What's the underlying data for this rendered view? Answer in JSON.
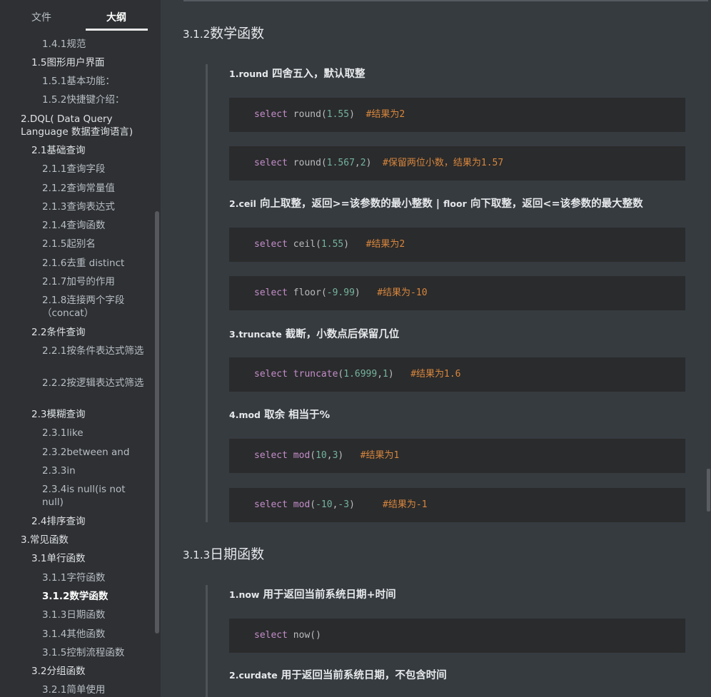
{
  "sidebar": {
    "tabs": {
      "files": "文件",
      "outline": "大纲"
    },
    "items": [
      {
        "level": 3,
        "text": "1.4.1规范"
      },
      {
        "level": 2,
        "text": "1.5图形用户界面"
      },
      {
        "level": 3,
        "text": "1.5.1基本功能："
      },
      {
        "level": 3,
        "text": "1.5.2快捷键介绍："
      },
      {
        "level": 1,
        "text": "2.DQL( Data Query Language 数据查询语言)"
      },
      {
        "level": 2,
        "text": "2.1基础查询"
      },
      {
        "level": 3,
        "text": "2.1.1查询字段"
      },
      {
        "level": 3,
        "text": "2.1.2查询常量值"
      },
      {
        "level": 3,
        "text": "2.1.3查询表达式"
      },
      {
        "level": 3,
        "text": "2.1.4查询函数"
      },
      {
        "level": 3,
        "text": "2.1.5起别名"
      },
      {
        "level": 3,
        "text": "2.1.6去重 distinct"
      },
      {
        "level": 3,
        "text": "2.1.7加号的作用"
      },
      {
        "level": 3,
        "text": "2.1.8连接两个字段（concat）"
      },
      {
        "level": 2,
        "text": "2.2条件查询"
      },
      {
        "level": 3,
        "text": "2.2.1按条件表达式筛选"
      },
      {
        "level": 3,
        "text": "2.2.2按逻辑表达式筛选"
      },
      {
        "level": 2,
        "text": "2.3模糊查询"
      },
      {
        "level": 3,
        "text": "2.3.1like"
      },
      {
        "level": 3,
        "text": "2.3.2between and"
      },
      {
        "level": 3,
        "text": "2.3.3in"
      },
      {
        "level": 3,
        "text": "2.3.4is null(is not null)"
      },
      {
        "level": 2,
        "text": "2.4排序查询"
      },
      {
        "level": 1,
        "text": "3.常见函数"
      },
      {
        "level": 2,
        "text": "3.1单行函数"
      },
      {
        "level": 3,
        "text": "3.1.1字符函数"
      },
      {
        "level": 3,
        "text": "3.1.2数学函数"
      },
      {
        "level": 3,
        "text": "3.1.3日期函数"
      },
      {
        "level": 3,
        "text": "3.1.4其他函数"
      },
      {
        "level": 3,
        "text": "3.1.5控制流程函数"
      },
      {
        "level": 2,
        "text": "3.2分组函数"
      },
      {
        "level": 3,
        "text": "3.2.1简单使用"
      }
    ]
  },
  "content": {
    "section_math": {
      "num": "3.1.2",
      "title": "数学函数"
    },
    "round_head": {
      "lat": "1.round",
      "rest": " 四舍五入，默认取整"
    },
    "code_round1": {
      "kw": "select",
      "fn": "round",
      "open": "(",
      "a": "1.55",
      "close": ")",
      "gap": "  ",
      "cmt": "#结果为2"
    },
    "code_round2": {
      "kw": "select",
      "fn": "round",
      "open": "(",
      "a": "1.567",
      "comma": ",",
      "b": "2",
      "close": ")",
      "gap": "  ",
      "cmt": "#保留两位小数，结果为1.57"
    },
    "ceil_head": {
      "lat1": "2.ceil",
      "mid1": " 向上取整，返回>=该参数的最小整数 | ",
      "lat2": "floor",
      "mid2": " 向下取整，返回<=该参数的最大整数"
    },
    "code_ceil": {
      "kw": "select",
      "fn": "ceil",
      "open": "(",
      "a": "1.55",
      "close": ")",
      "gap": "   ",
      "cmt": "#结果为2"
    },
    "code_floor": {
      "kw": "select",
      "fn": "floor",
      "open": "(",
      "a": "-9.99",
      "close": ")",
      "gap": "   ",
      "cmt": "#结果为-10"
    },
    "truncate_head": {
      "lat": "3.truncate",
      "rest": " 截断，小数点后保留几位"
    },
    "code_truncate": {
      "kw": "select",
      "fn": "truncate",
      "open": "(",
      "a": "1.6999",
      "comma": ",",
      "b": "1",
      "close": ")",
      "gap": "   ",
      "cmt": "#结果为1.6"
    },
    "mod_head": {
      "lat": "4.mod",
      "rest": " 取余 相当于%"
    },
    "code_mod1": {
      "kw": "select",
      "fn": "mod",
      "open": "(",
      "a": "10",
      "comma": ",",
      "b": "3",
      "close": ")",
      "gap": "   ",
      "cmt": "#结果为1"
    },
    "code_mod2": {
      "kw": "select",
      "fn": "mod",
      "open": "(",
      "a": "-10",
      "comma": ",",
      "b": "-3",
      "close": ")",
      "gap": "     ",
      "cmt": "#结果为-1"
    },
    "section_date": {
      "num": "3.1.3",
      "title": "日期函数"
    },
    "now_head": {
      "lat": "1.now",
      "rest": " 用于返回当前系统日期+时间"
    },
    "code_now": {
      "kw": "select",
      "fn": "now",
      "open": "(",
      "close": ")"
    },
    "curdate_head": {
      "lat": "2.curdate",
      "rest": " 用于返回当前系统日期，不包含时间"
    }
  }
}
